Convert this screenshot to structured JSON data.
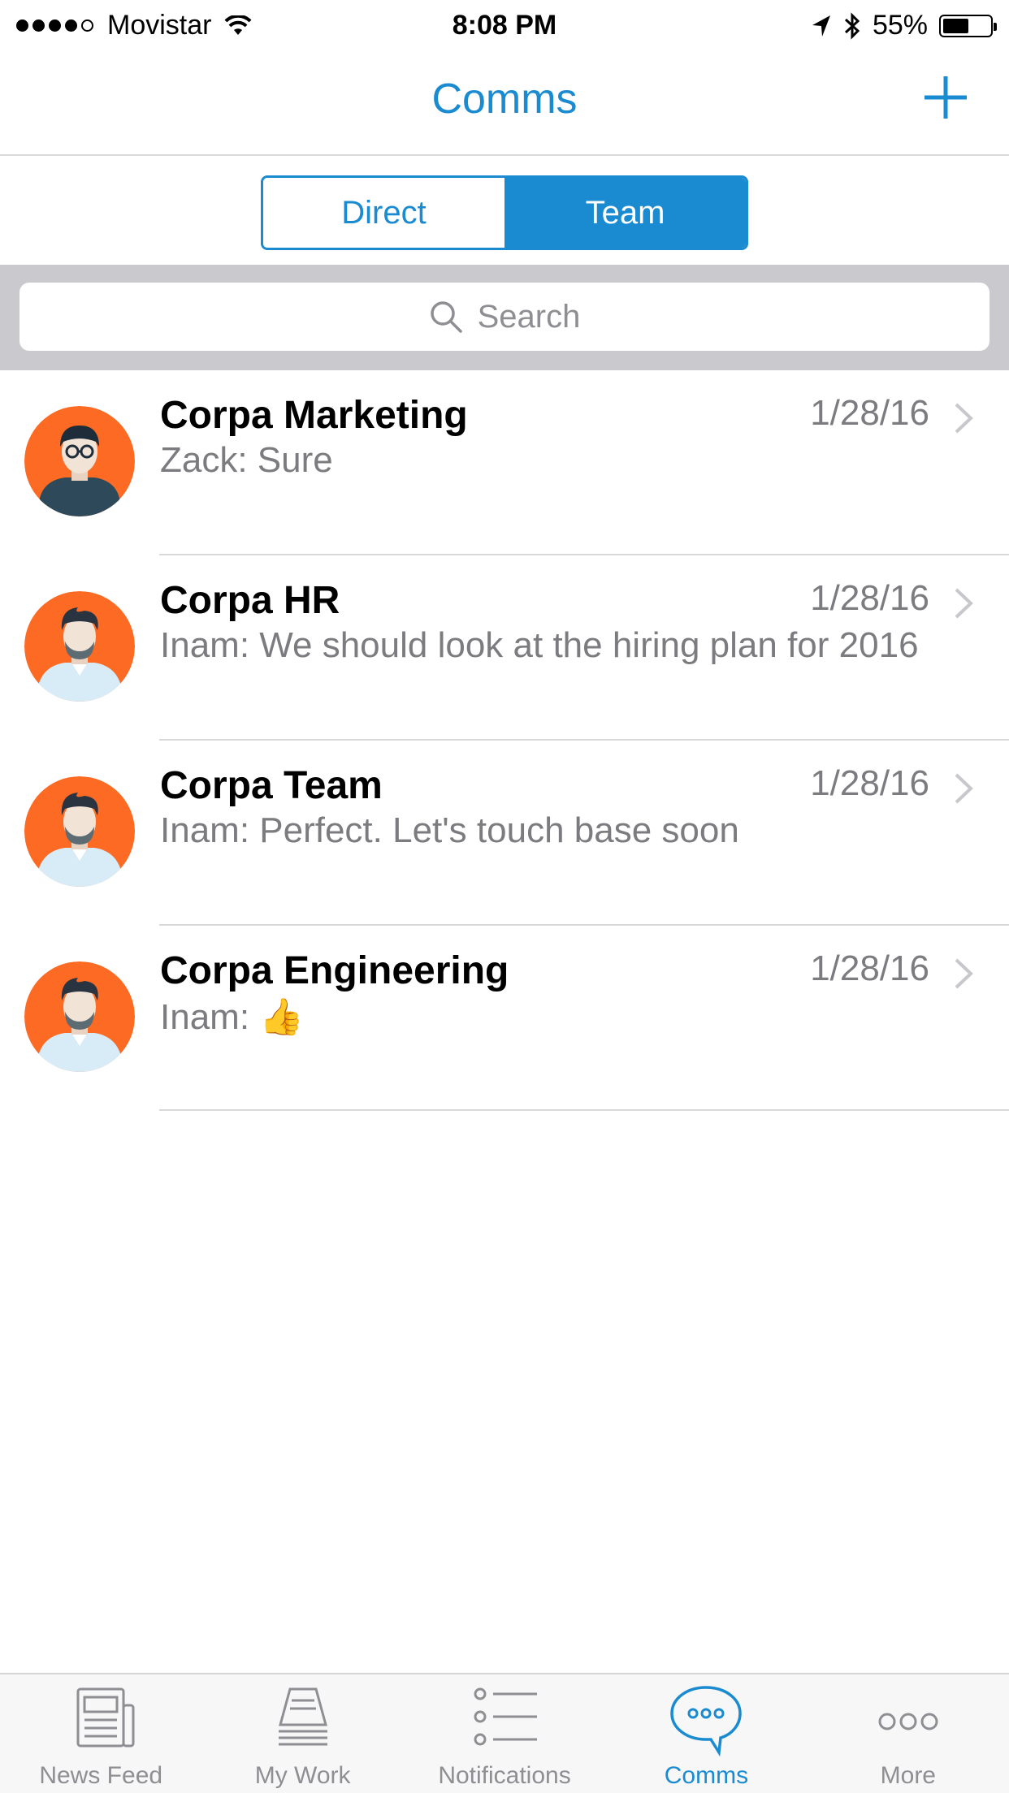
{
  "status_bar": {
    "carrier": "Movistar",
    "signal_bars_filled": 4,
    "time": "8:08 PM",
    "battery_text": "55%",
    "battery_level": 0.55
  },
  "nav": {
    "title": "Comms",
    "add_icon": "plus-icon"
  },
  "segments": {
    "direct_label": "Direct",
    "team_label": "Team",
    "selected": "Team"
  },
  "search": {
    "placeholder": "Search"
  },
  "conversations": [
    {
      "title": "Corpa Marketing",
      "date": "1/28/16",
      "message": "Zack: Sure",
      "avatar": "man-glasses-avatar"
    },
    {
      "title": "Corpa HR",
      "date": "1/28/16",
      "message": "Inam: We should look at the hiring plan for 2016",
      "avatar": "man-beard-avatar"
    },
    {
      "title": "Corpa Team",
      "date": "1/28/16",
      "message": "Inam: Perfect. Let's touch base soon",
      "avatar": "man-beard-avatar"
    },
    {
      "title": "Corpa Engineering",
      "date": "1/28/16",
      "message": "Inam: 👍",
      "avatar": "man-beard-avatar"
    }
  ],
  "tabs": [
    {
      "label": "News Feed",
      "icon": "newspaper-icon"
    },
    {
      "label": "My Work",
      "icon": "inbox-tray-icon"
    },
    {
      "label": "Notifications",
      "icon": "list-icon"
    },
    {
      "label": "Comms",
      "icon": "chat-bubble-icon",
      "active": true
    },
    {
      "label": "More",
      "icon": "more-dots-icon"
    }
  ],
  "colors": {
    "accent": "#1b8bd1",
    "avatar_bg": "#fd6a24",
    "secondary_text": "#7c7c80",
    "search_bg": "#c9c9ce"
  }
}
